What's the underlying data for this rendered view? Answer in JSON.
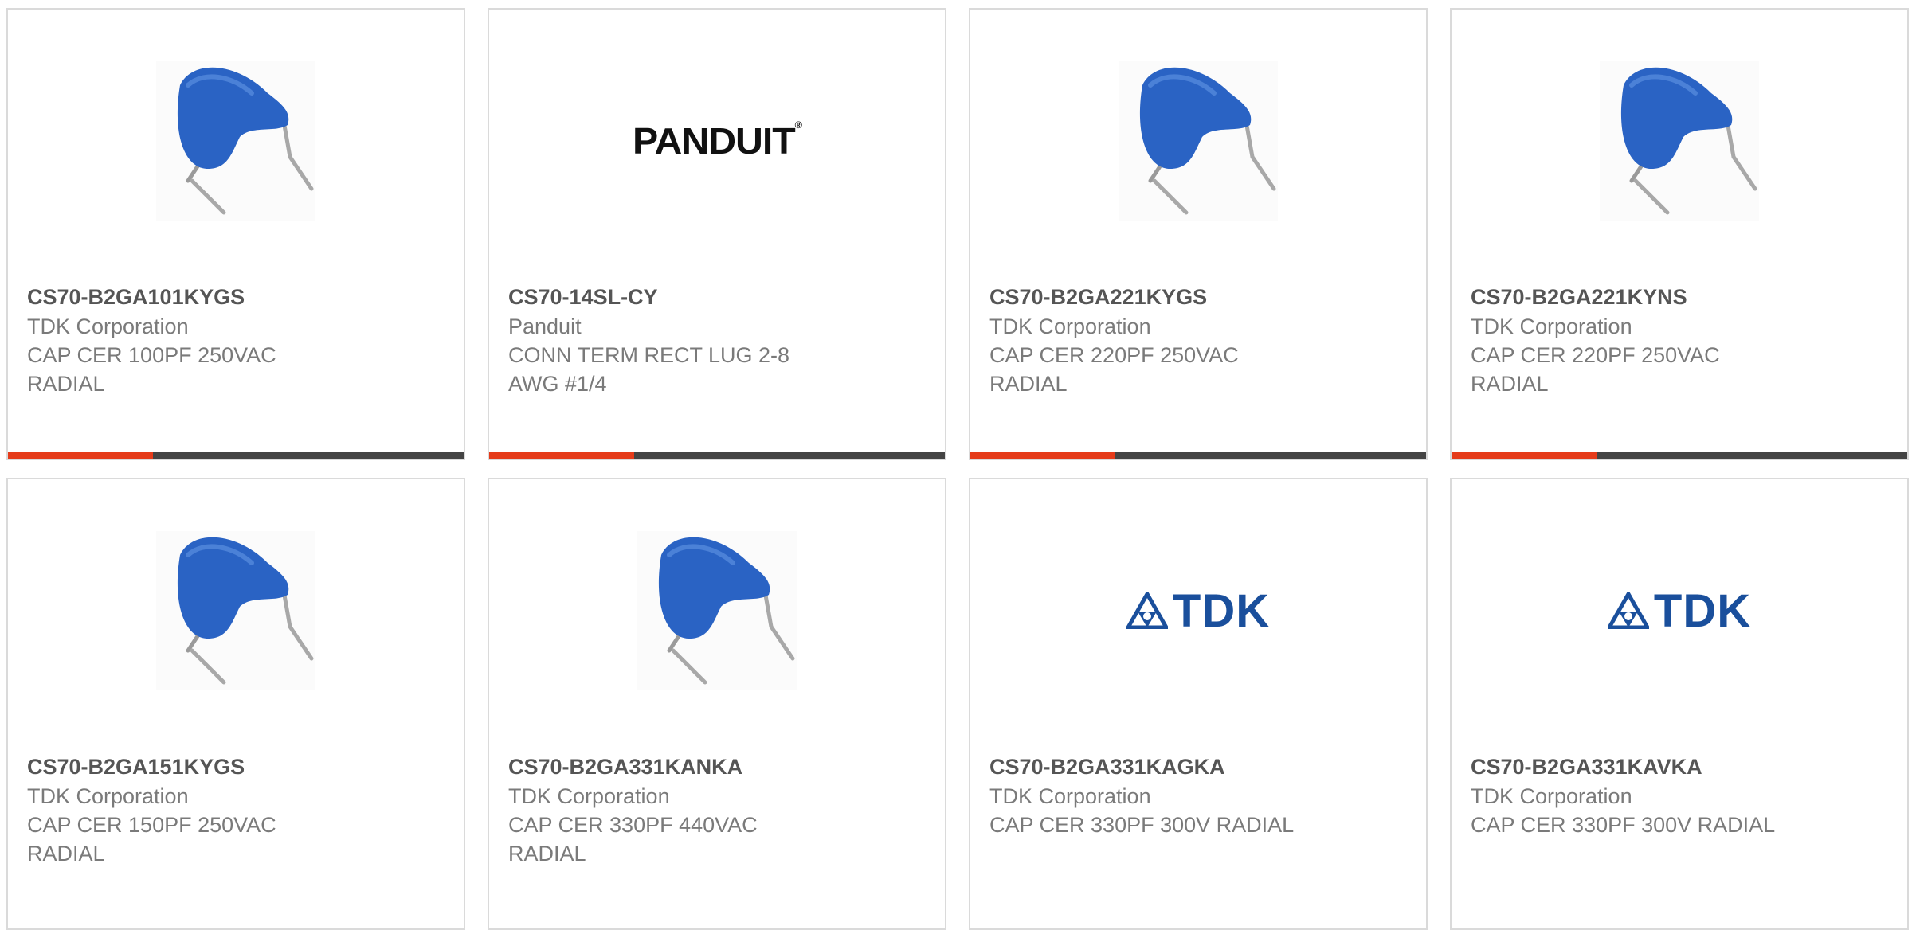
{
  "products": [
    {
      "part_number": "CS70-B2GA101KYGS",
      "manufacturer": "TDK Corporation",
      "description": "CAP CER 100PF 250VAC RADIAL",
      "image": "ceramic-capacitor-image"
    },
    {
      "part_number": "CS70-14SL-CY",
      "manufacturer": "Panduit",
      "description": "CONN TERM RECT LUG 2-8 AWG #1/4",
      "image": "panduit-logo",
      "logo_text": "PANDUIT"
    },
    {
      "part_number": "CS70-B2GA221KYGS",
      "manufacturer": "TDK Corporation",
      "description": "CAP CER 220PF 250VAC RADIAL",
      "image": "ceramic-capacitor-image"
    },
    {
      "part_number": "CS70-B2GA221KYNS",
      "manufacturer": "TDK Corporation",
      "description": "CAP CER 220PF 250VAC RADIAL",
      "image": "ceramic-capacitor-image"
    },
    {
      "part_number": "CS70-B2GA151KYGS",
      "manufacturer": "TDK Corporation",
      "description": "CAP CER 150PF 250VAC RADIAL",
      "image": "ceramic-capacitor-image"
    },
    {
      "part_number": "CS70-B2GA331KANKA",
      "manufacturer": "TDK Corporation",
      "description": "CAP CER 330PF 440VAC RADIAL",
      "image": "ceramic-capacitor-image"
    },
    {
      "part_number": "CS70-B2GA331KAGKA",
      "manufacturer": "TDK Corporation",
      "description": "CAP CER 330PF 300V RADIAL",
      "image": "tdk-logo",
      "logo_text": "TDK"
    },
    {
      "part_number": "CS70-B2GA331KAVKA",
      "manufacturer": "TDK Corporation",
      "description": "CAP CER 330PF 300V RADIAL",
      "image": "tdk-logo",
      "logo_text": "TDK"
    }
  ],
  "colors": {
    "accent": "#e53b1a",
    "bar": "#444444",
    "part_text": "#555555",
    "body_text": "#7a7a7a",
    "capacitor_blue": "#2a63c4",
    "tdk_blue": "#1a4f9c"
  }
}
